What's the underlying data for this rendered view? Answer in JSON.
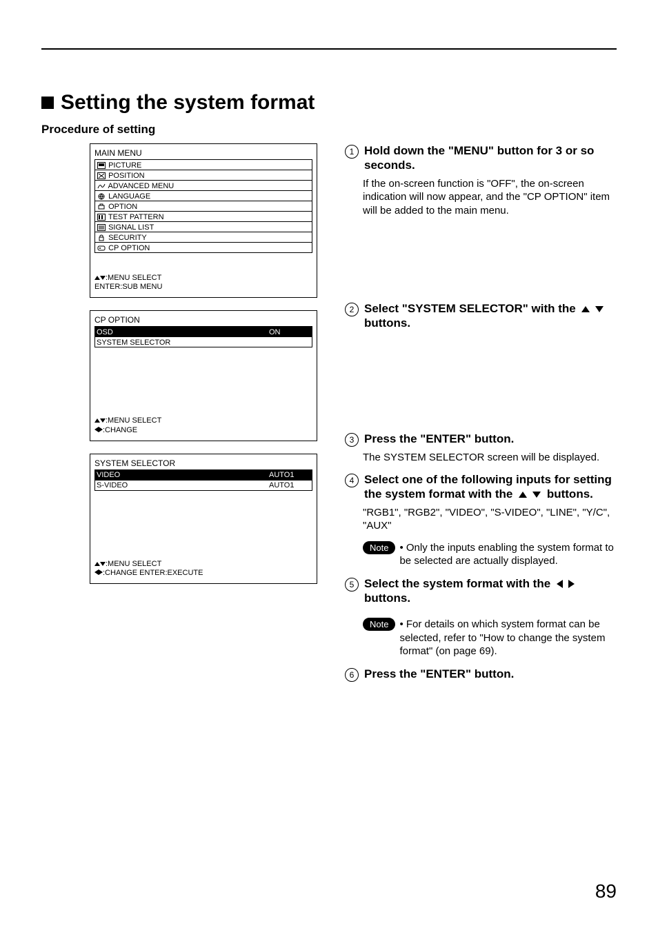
{
  "page_number": "89",
  "title": "Setting the system format",
  "subtitle": "Procedure of setting",
  "menu1": {
    "heading": "MAIN MENU",
    "items": [
      "PICTURE",
      "POSITION",
      "ADVANCED MENU",
      "LANGUAGE",
      "OPTION",
      "TEST PATTERN",
      "SIGNAL LIST",
      "SECURITY",
      "CP OPTION"
    ],
    "footer1": ":MENU SELECT",
    "footer2": "ENTER:SUB MENU"
  },
  "menu2": {
    "heading": "CP OPTION",
    "rows": [
      {
        "k": "OSD",
        "v": "ON",
        "hl": true
      },
      {
        "k": "SYSTEM SELECTOR",
        "v": "",
        "hl": false
      }
    ],
    "footer1": ":MENU SELECT",
    "footer2": ":CHANGE"
  },
  "menu3": {
    "heading": "SYSTEM SELECTOR",
    "rows": [
      {
        "k": "VIDEO",
        "v": "AUTO1",
        "hl": true
      },
      {
        "k": "S-VIDEO",
        "v": "AUTO1",
        "hl": false
      }
    ],
    "footer1": ":MENU SELECT",
    "footer2": ":CHANGE   ENTER:EXECUTE"
  },
  "steps": {
    "s1": {
      "bold": "Hold down the \"MENU\" button for 3 or so seconds.",
      "desc": "If the on-screen function is \"OFF\", the on-screen indication will now appear, and the \"CP OPTION\" item will be added to the main menu."
    },
    "s2": {
      "bold_pre": "Select \"SYSTEM SELECTOR\" with the",
      "bold_post": "buttons."
    },
    "s3": {
      "bold": "Press the \"ENTER\" button.",
      "desc": "The SYSTEM SELECTOR screen will be displayed."
    },
    "s4": {
      "bold_pre": "Select one of the following inputs for setting the system format with the",
      "bold_post": "buttons.",
      "desc": "\"RGB1\", \"RGB2\", \"VIDEO\", \"S-VIDEO\", \"LINE\", \"Y/C\", \"AUX\""
    },
    "note1": "Only the inputs enabling the system format to be selected are actually displayed.",
    "s5": {
      "bold_pre": "Select the system format with the",
      "bold_post": "buttons."
    },
    "note2": "For details on which system format can be selected, refer to \"How to change the system format\" (on page 69).",
    "s6": {
      "bold": "Press the \"ENTER\" button."
    }
  },
  "labels": {
    "note": "Note"
  }
}
